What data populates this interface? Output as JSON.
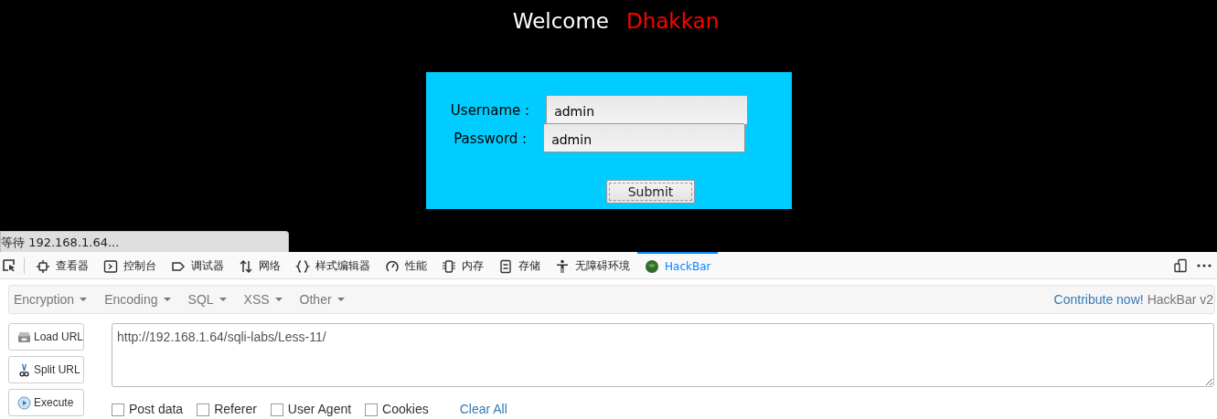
{
  "page": {
    "welcome": "Welcome",
    "name": "Dhakkan",
    "form": {
      "fields": [
        {
          "label": "Username :",
          "value": "admin"
        },
        {
          "label": "Password :",
          "value": "admin"
        }
      ],
      "submit": "Submit"
    }
  },
  "status_tooltip": "等待 192.168.1.64...",
  "devtools": {
    "tabs": [
      {
        "kind": "inspector",
        "label": "查看器",
        "selected": false
      },
      {
        "kind": "console",
        "label": "控制台",
        "selected": false
      },
      {
        "kind": "debugger",
        "label": "调试器",
        "selected": false
      },
      {
        "kind": "network",
        "label": "网络",
        "selected": false
      },
      {
        "kind": "style",
        "label": "样式编辑器",
        "selected": false
      },
      {
        "kind": "performance",
        "label": "性能",
        "selected": false
      },
      {
        "kind": "memory",
        "label": "内存",
        "selected": false
      },
      {
        "kind": "storage",
        "label": "存储",
        "selected": false
      },
      {
        "kind": "accessibility",
        "label": "无障碍环境",
        "selected": false
      },
      {
        "kind": "hackbar",
        "label": "HackBar",
        "selected": true
      }
    ]
  },
  "hackbar": {
    "menus": [
      "Encryption",
      "Encoding",
      "SQL",
      "XSS",
      "Other"
    ],
    "contribute": "Contribute now!",
    "version": "HackBar v2",
    "buttons": [
      {
        "kind": "load",
        "label": "Load URL"
      },
      {
        "kind": "split",
        "label": "Split URL"
      },
      {
        "kind": "execute",
        "label": "Execute"
      }
    ],
    "url": "http://192.168.1.64/sqli-labs/Less-11/",
    "options": [
      {
        "label": "Post data",
        "checked": false
      },
      {
        "label": "Referer",
        "checked": false
      },
      {
        "label": "User Agent",
        "checked": false
      },
      {
        "label": "Cookies",
        "checked": false
      }
    ],
    "clear_all": "Clear All"
  }
}
